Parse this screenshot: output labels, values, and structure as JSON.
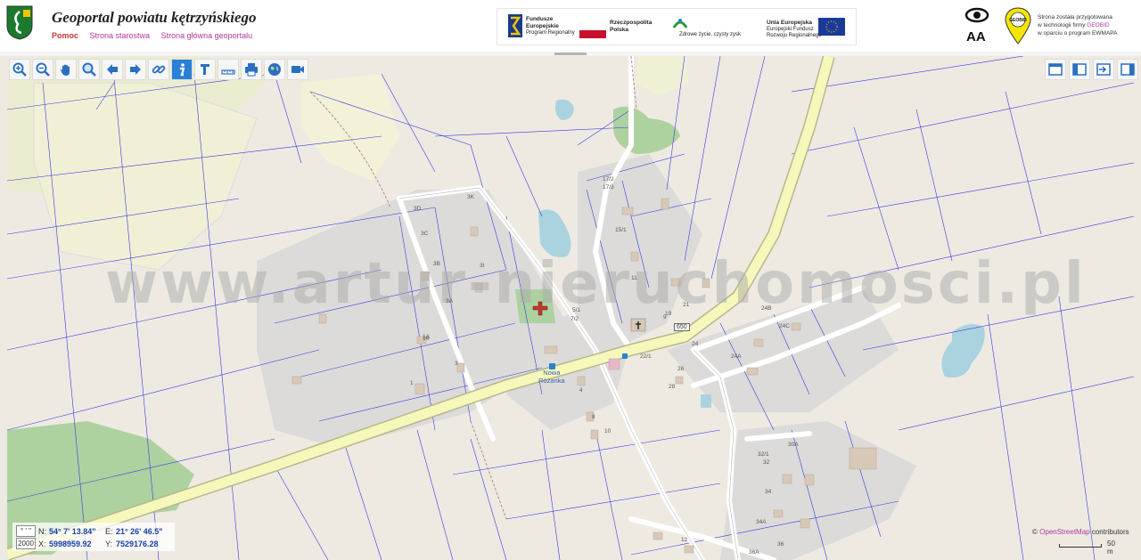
{
  "header": {
    "title": "Geoportal powiatu kętrzyńskiego",
    "links": [
      "Pomoc",
      "Strona starostwa",
      "Strona główna geoportalu"
    ],
    "eu_logos": {
      "fe_line1": "Fundusze",
      "fe_line2": "Europejskie",
      "fe_line3": "Program Regionalny",
      "rp_line1": "Rzeczpospolita",
      "rp_line2": "Polska",
      "warmia_text": "Zdrowe życie, czysty zysk",
      "ue_line1": "Unia Europejska",
      "ue_line2": "Europejski Fundusz",
      "ue_line3": "Rozwoju Regionalnego"
    },
    "font_size_label": "AA",
    "geobid_logo": "GEOBID",
    "geobid_text_1": "Strona została przygotowana",
    "geobid_text_2": "w technologii firmy",
    "geobid_highlight": "GEOBID",
    "geobid_text_3": "w oparciu o program EWMAPA"
  },
  "toolbar": {
    "tools": [
      "zoom-in",
      "zoom-out",
      "pan",
      "zoom-box",
      "back",
      "forward",
      "link",
      "info",
      "measure-pen",
      "ruler",
      "print",
      "globe",
      "camera"
    ],
    "right_tools": [
      "layout-full",
      "layout-left",
      "layout-export",
      "layout-right"
    ]
  },
  "map": {
    "watermark": "www.artur-nieruchomosci.pl",
    "place_label": "Nowa",
    "place_label_2": "Różanka",
    "road_number": "650",
    "parcel_labels": [
      "3D",
      "3C",
      "3B",
      "3A",
      "3I",
      "3K",
      "1A",
      "1",
      "3",
      "4",
      "8",
      "10",
      "11",
      "15/1",
      "17/2",
      "17/3",
      "19",
      "21",
      "22/1",
      "24",
      "24A",
      "24B",
      "24C",
      "26",
      "28",
      "30A",
      "32/1",
      "32",
      "34",
      "34A",
      "36",
      "36A",
      "5/1",
      "7/2",
      "9",
      "12",
      "14"
    ]
  },
  "coords": {
    "scale_value": "2000",
    "n_label": "N:",
    "n_value": "54° 7' 13.84\"",
    "e_label": "E:",
    "e_value": "21° 26' 46.5\"",
    "x_label": "X:",
    "x_value": "5998959.92",
    "y_label": "Y:",
    "y_value": "7529176.28"
  },
  "attribution": {
    "prefix": "©",
    "osm": "OpenStreetMap",
    "suffix": "contributors"
  },
  "scalebar": {
    "label": "50 m"
  },
  "colors": {
    "accent": "#2a7fd6",
    "link": "#b0369a",
    "main_road": "#f6f7bb",
    "parcel_line": "#3a3ae0",
    "forest": "#aed1a0",
    "water": "#aad3df"
  }
}
